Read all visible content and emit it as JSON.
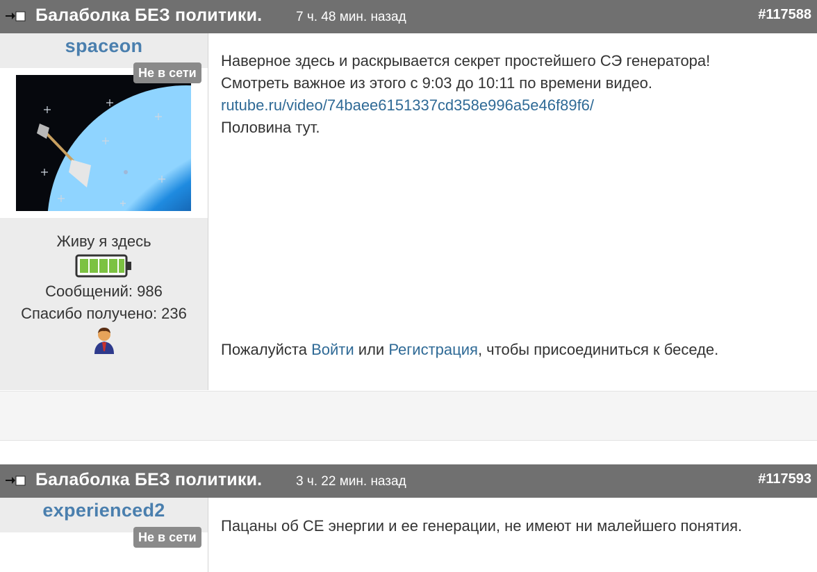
{
  "posts": [
    {
      "title": "Балаболка БЕЗ политики.",
      "time": "7 ч. 48 мин. назад",
      "id": "#117588",
      "username": "spaceon",
      "status": "Не в сети",
      "rank": "Живу я здесь",
      "messages": "Сообщений: 986",
      "thanks": "Спасибо получено: 236",
      "body": [
        "Наверное здесь и раскрывается секрет простейшего СЭ генератора!",
        "Смотреть важное из этого с 9:03 до 10:11 по времени видео."
      ],
      "link": "rutube.ru/video/74baee6151337cd358e996a5e46f89f6/",
      "body_after": "Половина тут.",
      "login_prompt": {
        "before": "Пожалуйста",
        "login": "Войти",
        "or": "или",
        "register": "Регистрация",
        "after": ", чтобы присоединиться к беседе."
      }
    },
    {
      "title": "Балаболка БЕЗ политики.",
      "time": "3 ч. 22 мин. назад",
      "id": "#117593",
      "username": "experienced2",
      "status": "Не в сети",
      "body": [
        "Пацаны об СЕ энергии и ее генерации, не имеют ни малейшего понятия."
      ]
    }
  ],
  "colors": {
    "header_bg": "#707070",
    "username": "#4a7fae",
    "link": "#2f6a96",
    "sidebar_bg": "#ececec",
    "battery": "#7cc242"
  },
  "icons": {
    "header": "post-collapse-icon",
    "rank": "user-rank-icon",
    "battery": "activity-battery-icon"
  }
}
